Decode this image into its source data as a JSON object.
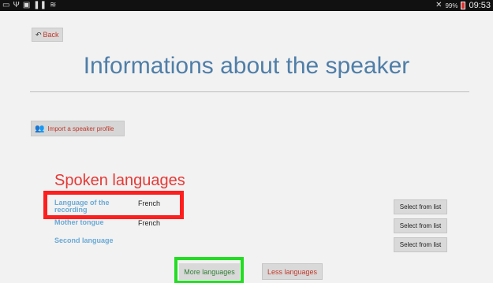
{
  "status_bar": {
    "icons_left": [
      "cast-icon",
      "usb-icon",
      "gallery-icon",
      "pause-icon",
      "wifi-icon"
    ],
    "battery": "99%",
    "time": "09:53",
    "signal_icon": "no-signal-icon"
  },
  "back_button": {
    "label": "Back",
    "icon": "back-arrow-icon"
  },
  "page": {
    "title": "Informations about the speaker"
  },
  "import_button": {
    "label": "Import a speaker profile",
    "icon": "people-icon"
  },
  "section": {
    "title": "Spoken languages"
  },
  "languages": [
    {
      "label": "Language of the recording",
      "value": "French",
      "button": "Select from list"
    },
    {
      "label": "Mother tongue",
      "value": "French",
      "button": "Select from list"
    },
    {
      "label": "Second language",
      "value": "",
      "button": "Select from list"
    }
  ],
  "footer_buttons": {
    "more": "More languages",
    "less": "Less languages"
  },
  "colors": {
    "title": "#4f7ea8",
    "section": "#e53935",
    "label": "#6aaad6",
    "highlight_red": "#ff1e1e",
    "highlight_green": "#22dd22"
  }
}
